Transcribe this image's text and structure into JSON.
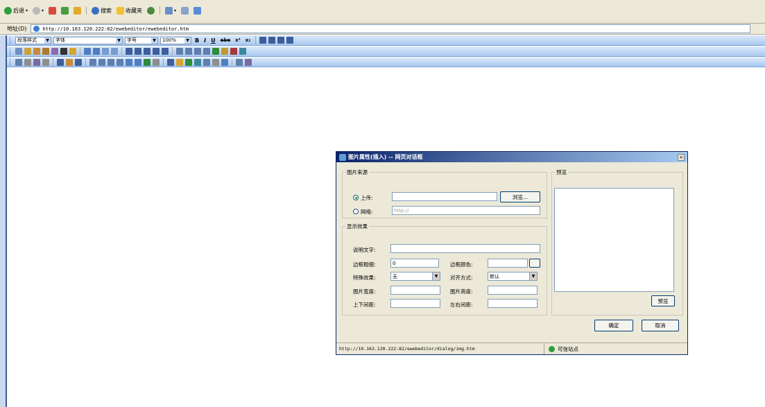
{
  "browser": {
    "toolbar": {
      "back_label": "后退",
      "search_label": "搜索",
      "favorites_label": "收藏夹"
    },
    "address": {
      "label": "地址(D)",
      "url": "http://10.163.120.222:82/ewebeditor/ewebeditor.htm"
    }
  },
  "editor": {
    "toolbar1": {
      "para_style": "段落样式",
      "font": "字体",
      "font_size": "字号",
      "zoom": "100%",
      "bold": "B",
      "italic": "I",
      "underline": "U",
      "strike": "abe",
      "superscript": "x²",
      "subscript": "x₂"
    }
  },
  "dialog": {
    "title": "图片属性(插入) -- 网页对话框",
    "close_glyph": "×",
    "source_group": {
      "legend": "图片来源",
      "upload_label": "上传:",
      "browse_button": "浏览...",
      "web_label": "网络:",
      "web_placeholder": "http://"
    },
    "display_group": {
      "legend": "显示效果",
      "alt_text_label": "说明文字:",
      "border_width_label": "边框粗细:",
      "border_width_value": "0",
      "border_color_label": "边框颜色:",
      "effect_label": "特殊效果:",
      "effect_value": "无",
      "align_label": "对齐方式:",
      "align_value": "默认",
      "width_label": "图片宽度:",
      "height_label": "图片高度:",
      "vspace_label": "上下间距:",
      "hspace_label": "左右间距:"
    },
    "preview_group": {
      "legend": "预览",
      "preview_button": "预览"
    },
    "ok_button": "确定",
    "cancel_button": "取消",
    "status": {
      "url": "http://10.163.120.222:82/ewebeditor/dialog/img.htm",
      "zone": "可信站点"
    }
  }
}
